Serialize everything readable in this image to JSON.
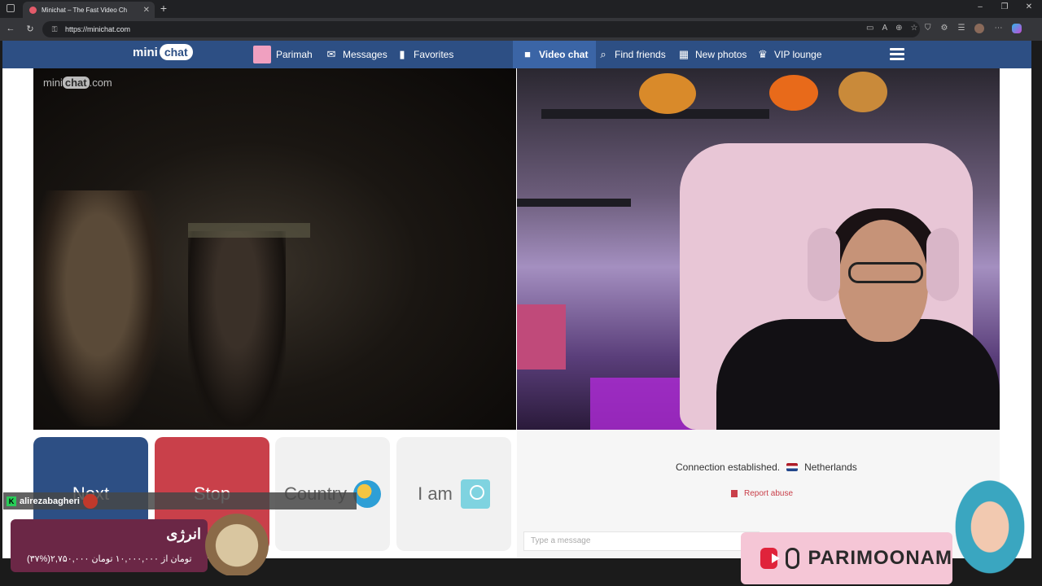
{
  "browser": {
    "tab_title": "Minichat – The Fast Video Ch",
    "url": "https://minichat.com"
  },
  "nav": {
    "logo_mini": "mini",
    "logo_chat": "chat",
    "items": [
      {
        "label": "Parimah"
      },
      {
        "label": "Messages"
      },
      {
        "label": "Favorites"
      },
      {
        "label": "Video chat"
      },
      {
        "label": "Find friends"
      },
      {
        "label": "New photos"
      },
      {
        "label": "VIP lounge"
      }
    ]
  },
  "video": {
    "watermark_mini": "mini",
    "watermark_chat": "chat",
    "watermark_com": ".com"
  },
  "controls": {
    "next": "Next",
    "stop": "Stop",
    "country": "Country",
    "iam": "I am"
  },
  "chat": {
    "status": "Connection established.",
    "country": "Netherlands",
    "report": "Report abuse",
    "placeholder": "Type a message"
  },
  "overlay": {
    "username": "alirezabagheri",
    "banner_title": "انرژی",
    "banner_sub": "(۳۷%)۲,۷۵۰,۰۰۰ تومان از ۱۰,۰۰۰,۰۰۰ تومان",
    "social_name": "PARIMOONAM"
  },
  "colors": {
    "nav_bg": "#2d4f84",
    "next_bg": "#2d4f84",
    "stop_bg": "#c9404a"
  }
}
